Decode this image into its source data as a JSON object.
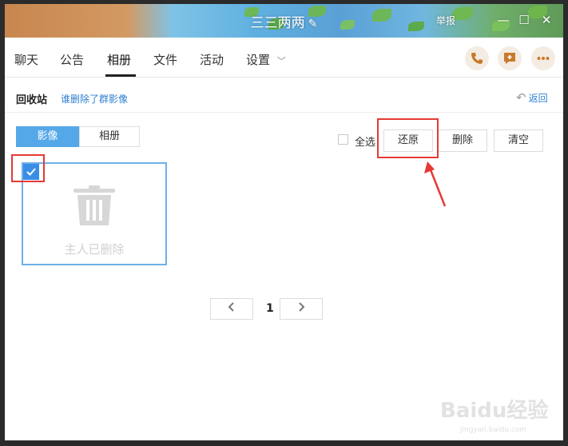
{
  "window": {
    "title": "三三两两"
  },
  "titlebar": {
    "report_label": "举报",
    "minimize": "—",
    "maximize": "☐",
    "close": "✕"
  },
  "nav": {
    "tabs": [
      {
        "label": "聊天"
      },
      {
        "label": "公告"
      },
      {
        "label": "相册"
      },
      {
        "label": "文件"
      },
      {
        "label": "活动"
      },
      {
        "label": "设置"
      }
    ],
    "active_tab": "相册"
  },
  "subheader": {
    "title": "回收站",
    "link": "谁删除了群影像",
    "back_label": "返回"
  },
  "toolbar": {
    "segments": [
      {
        "label": "影像"
      },
      {
        "label": "相册"
      }
    ],
    "select_all_label": "全选",
    "restore_label": "还原",
    "delete_label": "删除",
    "clear_label": "清空"
  },
  "card": {
    "text": "主人已删除",
    "checked": true
  },
  "pagination": {
    "current": "1"
  },
  "watermark": {
    "text": "Baidu经验",
    "sub": "jingyan.baidu.com"
  },
  "colors": {
    "accent": "#55a8e8",
    "highlight": "#e53935",
    "link": "#2f7fd0",
    "icon_accent": "#c77a2c"
  }
}
